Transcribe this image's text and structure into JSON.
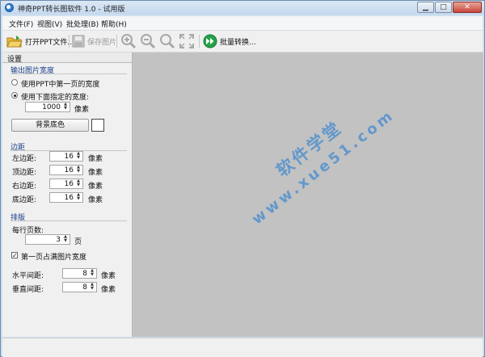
{
  "window": {
    "title": "神奇PPT转长图软件 1.0 - 试用版"
  },
  "menu": [
    {
      "label": "文件(F)"
    },
    {
      "label": "视图(V)"
    },
    {
      "label": "批处理(B)"
    },
    {
      "label": "帮助(H)"
    }
  ],
  "toolbar": {
    "open_label": "打开PPT文件...",
    "save_label": "保存图片",
    "batch_label": "批量转换..."
  },
  "settings": {
    "header": "设置",
    "output": {
      "title": "输出图片宽度",
      "option_first_page": "使用PPT中第一页的宽度",
      "option_custom": "使用下面指定的宽度:",
      "width_value": "1000",
      "width_unit": "像素",
      "bg_color_button": "背景底色"
    },
    "margins": {
      "title": "边距",
      "left_label": "左边距:",
      "left_value": "16",
      "top_label": "顶边距:",
      "top_value": "16",
      "right_label": "右边距:",
      "right_value": "16",
      "bottom_label": "底边距:",
      "bottom_value": "16",
      "unit": "像素"
    },
    "layout": {
      "title": "排版",
      "pages_per_row_label": "每行页数:",
      "pages_per_row_value": "3",
      "pages_unit": "页",
      "fill_width_label": "第一页占满图片宽度",
      "h_spacing_label": "水平间距:",
      "h_spacing_value": "8",
      "v_spacing_label": "垂直间距:",
      "v_spacing_value": "8",
      "unit": "像素"
    }
  },
  "watermark": {
    "cn": "软件学堂",
    "en": "www.xue51.com"
  }
}
